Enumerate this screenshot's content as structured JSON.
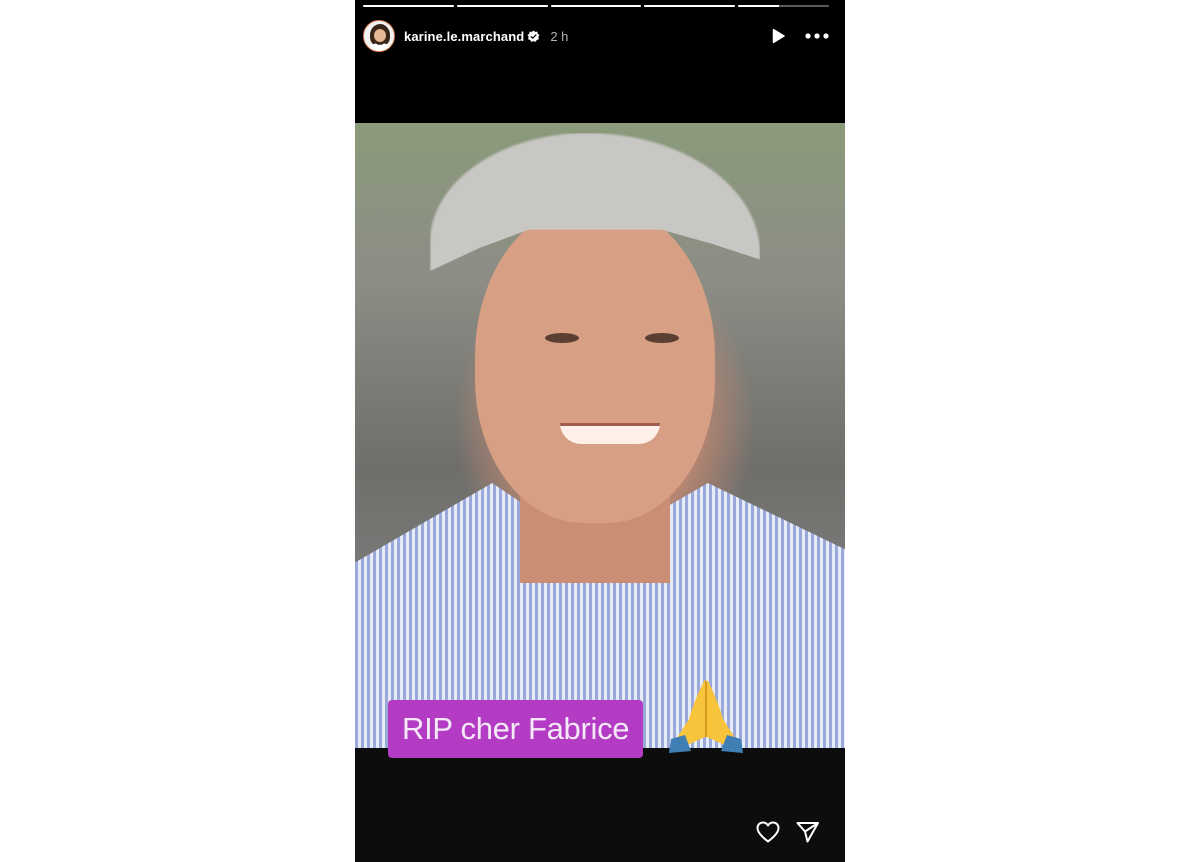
{
  "story": {
    "username": "karine.le.marchand",
    "time": "2 h",
    "progress": [
      1,
      1,
      1,
      1,
      0.45,
      0
    ],
    "caption": "RIP cher Fabrice",
    "icons": {
      "avatar": "profile-avatar",
      "verified": "verified-badge-icon",
      "play": "play-icon",
      "more": "more-icon",
      "like": "heart-icon",
      "share": "send-icon",
      "emoji": "praying-hands-emoji"
    }
  }
}
